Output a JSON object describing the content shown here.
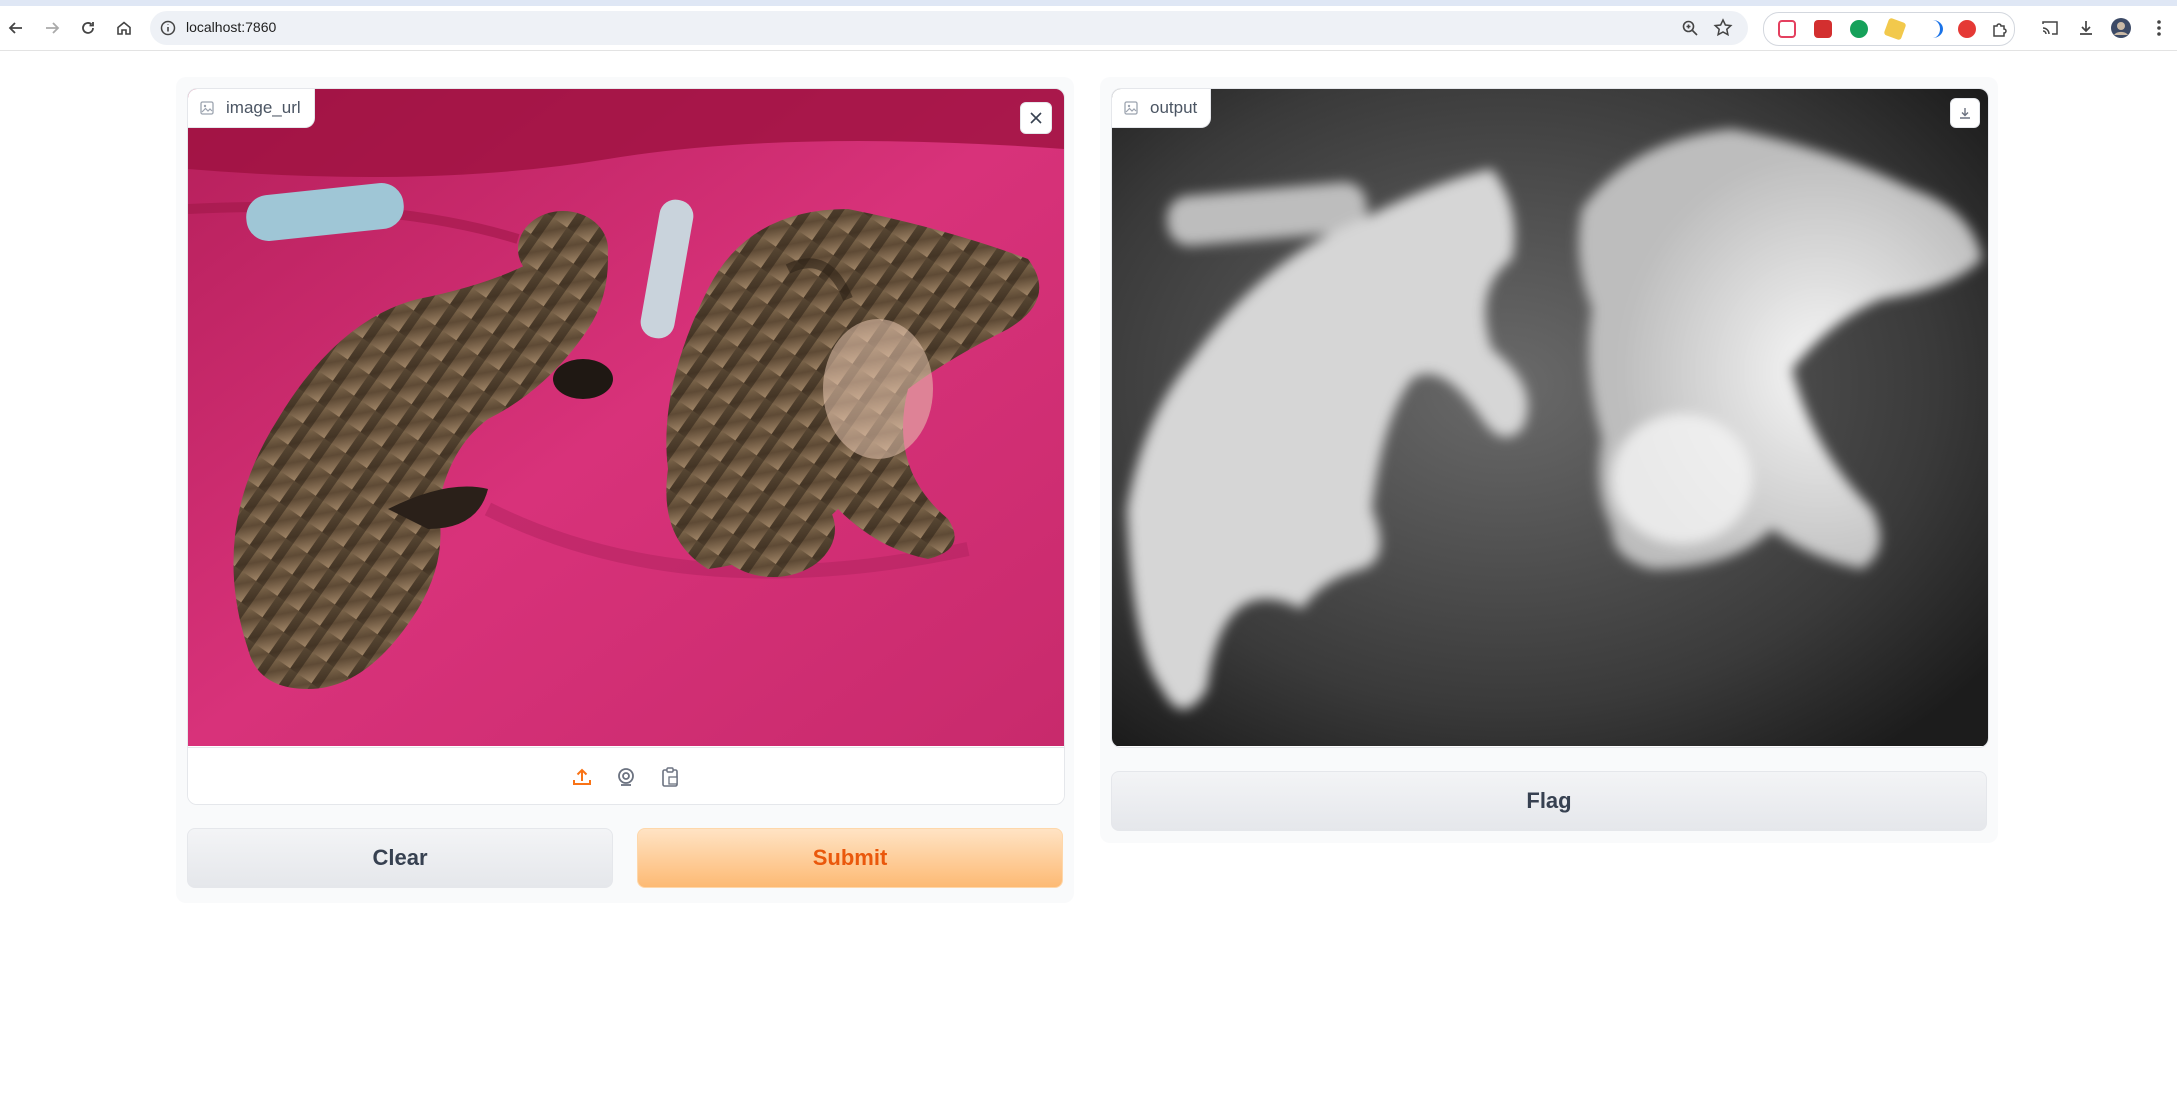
{
  "browser": {
    "url": "localhost:7860",
    "accent_color": "#f97316"
  },
  "input_image": {
    "label": "image_url",
    "clear_icon": "close-icon",
    "sources": [
      "upload-icon",
      "webcam-icon",
      "clipboard-icon"
    ]
  },
  "output_image": {
    "label": "output",
    "download_icon": "download-icon"
  },
  "buttons": {
    "clear_label": "Clear",
    "submit_label": "Submit",
    "flag_label": "Flag"
  },
  "colors": {
    "primary_bg": "#fdba74",
    "primary_text": "#ea580c",
    "secondary_bg": "#e5e7eb"
  }
}
